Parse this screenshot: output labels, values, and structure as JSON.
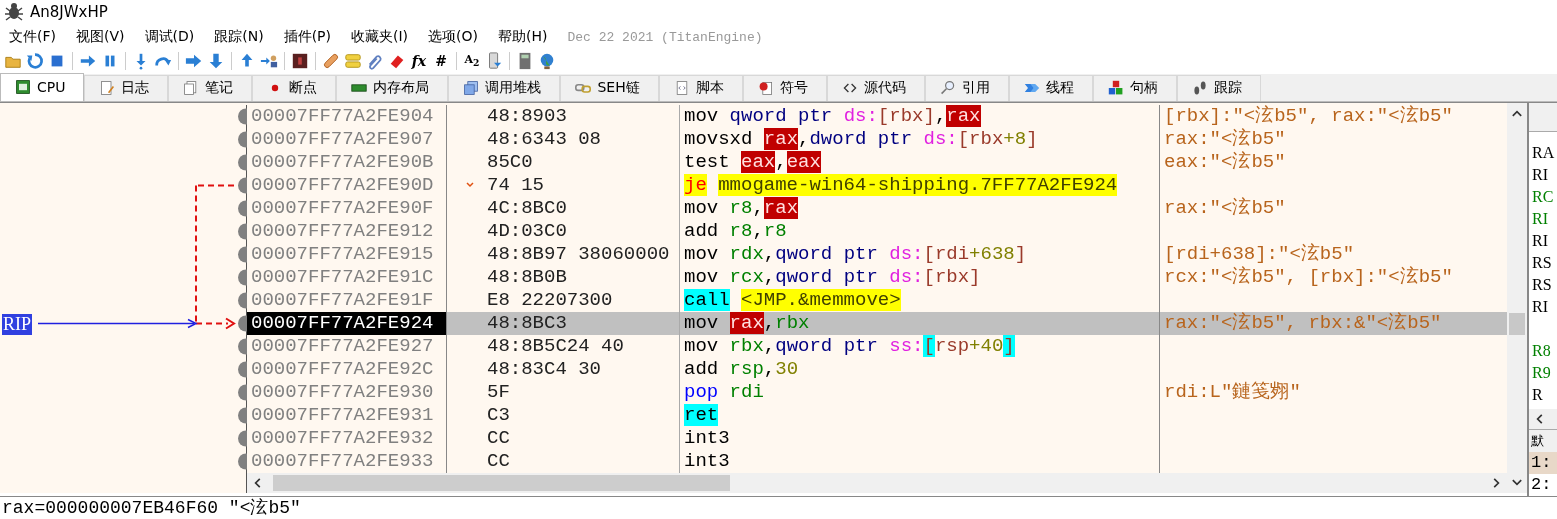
{
  "window": {
    "title": "An8JWxHP"
  },
  "menu": [
    {
      "label": "文件(F)"
    },
    {
      "label": "视图(V)"
    },
    {
      "label": "调试(D)"
    },
    {
      "label": "跟踪(N)"
    },
    {
      "label": "插件(P)"
    },
    {
      "label": "收藏夹(I)"
    },
    {
      "label": "选项(O)"
    },
    {
      "label": "帮助(H)"
    }
  ],
  "build_info": "Dec 22 2021 (TitanEngine)",
  "toolbar": {
    "glyphs": [
      "fx",
      "#",
      "A$_{2}$"
    ]
  },
  "tabs": [
    {
      "label": "CPU",
      "selected": true
    },
    {
      "label": "日志",
      "selected": false
    },
    {
      "label": "笔记",
      "selected": false
    },
    {
      "label": "断点",
      "selected": false
    },
    {
      "label": "内存布局",
      "selected": false
    },
    {
      "label": "调用堆栈",
      "selected": false
    },
    {
      "label": "SEH链",
      "selected": false
    },
    {
      "label": "脚本",
      "selected": false
    },
    {
      "label": "符号",
      "selected": false
    },
    {
      "label": "源代码",
      "selected": false
    },
    {
      "label": "引用",
      "selected": false
    },
    {
      "label": "线程",
      "selected": false
    },
    {
      "label": "句柄",
      "selected": false
    },
    {
      "label": "跟踪",
      "selected": false
    }
  ],
  "disassembly": {
    "rip_label": "RIP",
    "rows": [
      {
        "address": "00007FF77A2FE904",
        "bytes": "48:8903",
        "selected": false,
        "rip": false,
        "jump_source": false,
        "jump_target": false,
        "tokens": [
          {
            "t": "mov ",
            "kind": "op"
          },
          {
            "t": "qword ptr ",
            "kind": "size"
          },
          {
            "t": "ds:",
            "kind": "seg"
          },
          {
            "t": "[rbx]",
            "kind": "mem"
          },
          {
            "t": ",",
            "kind": "punct"
          },
          {
            "t": "rax",
            "kind": "reg_hl"
          }
        ],
        "comment": "[rbx]:\"<泫b5\", rax:\"<泫b5\""
      },
      {
        "address": "00007FF77A2FE907",
        "bytes": "48:6343 08",
        "selected": false,
        "rip": false,
        "jump_source": false,
        "jump_target": false,
        "tokens": [
          {
            "t": "movsxd ",
            "kind": "op"
          },
          {
            "t": "rax",
            "kind": "reg_hl"
          },
          {
            "t": ",",
            "kind": "punct"
          },
          {
            "t": "dword ptr ",
            "kind": "size"
          },
          {
            "t": "ds:",
            "kind": "seg"
          },
          {
            "t": "[rbx",
            "kind": "mem"
          },
          {
            "t": "+8",
            "kind": "num"
          },
          {
            "t": "]",
            "kind": "mem"
          }
        ],
        "comment": "rax:\"<泫b5\""
      },
      {
        "address": "00007FF77A2FE90B",
        "bytes": "85C0",
        "selected": false,
        "rip": false,
        "jump_source": false,
        "jump_target": false,
        "tokens": [
          {
            "t": "test ",
            "kind": "op"
          },
          {
            "t": "eax",
            "kind": "reg_hl"
          },
          {
            "t": ",",
            "kind": "punct"
          },
          {
            "t": "eax",
            "kind": "reg_hl"
          }
        ],
        "comment": "eax:\"<泫b5\""
      },
      {
        "address": "00007FF77A2FE90D",
        "bytes": "74 15",
        "selected": false,
        "rip": false,
        "jump_source": true,
        "jump_target": false,
        "tokens": [
          {
            "t": "je",
            "kind": "jump"
          },
          {
            "t": "mmogame-win64-shipping.7FF77A2FE924",
            "kind": "label"
          }
        ]
      },
      {
        "address": "00007FF77A2FE90F",
        "bytes": "4C:8BC0",
        "selected": false,
        "rip": false,
        "jump_source": false,
        "jump_target": false,
        "tokens": [
          {
            "t": "mov ",
            "kind": "op"
          },
          {
            "t": "r8",
            "kind": "reg"
          },
          {
            "t": ",",
            "kind": "punct"
          },
          {
            "t": "rax",
            "kind": "reg_hl"
          }
        ],
        "comment": "rax:\"<泫b5\""
      },
      {
        "address": "00007FF77A2FE912",
        "bytes": "4D:03C0",
        "selected": false,
        "rip": false,
        "jump_source": false,
        "jump_target": false,
        "tokens": [
          {
            "t": "add ",
            "kind": "op"
          },
          {
            "t": "r8",
            "kind": "reg"
          },
          {
            "t": ",",
            "kind": "punct"
          },
          {
            "t": "r8",
            "kind": "reg"
          }
        ]
      },
      {
        "address": "00007FF77A2FE915",
        "bytes": "48:8B97 38060000",
        "selected": false,
        "rip": false,
        "jump_source": false,
        "jump_target": false,
        "tokens": [
          {
            "t": "mov ",
            "kind": "op"
          },
          {
            "t": "rdx",
            "kind": "reg"
          },
          {
            "t": ",",
            "kind": "punct"
          },
          {
            "t": "qword ptr ",
            "kind": "size"
          },
          {
            "t": "ds:",
            "kind": "seg"
          },
          {
            "t": "[rdi",
            "kind": "mem"
          },
          {
            "t": "+638",
            "kind": "num"
          },
          {
            "t": "]",
            "kind": "mem"
          }
        ],
        "comment": "[rdi+638]:\"<泫b5\""
      },
      {
        "address": "00007FF77A2FE91C",
        "bytes": "48:8B0B",
        "selected": false,
        "rip": false,
        "jump_source": false,
        "jump_target": false,
        "tokens": [
          {
            "t": "mov ",
            "kind": "op"
          },
          {
            "t": "rcx",
            "kind": "reg"
          },
          {
            "t": ",",
            "kind": "punct"
          },
          {
            "t": "qword ptr ",
            "kind": "size"
          },
          {
            "t": "ds:",
            "kind": "seg"
          },
          {
            "t": "[rbx]",
            "kind": "mem"
          }
        ],
        "comment": "rcx:\"<泫b5\", [rbx]:\"<泫b5\""
      },
      {
        "address": "00007FF77A2FE91F",
        "bytes": "E8 22207300",
        "selected": false,
        "rip": false,
        "jump_source": false,
        "jump_target": false,
        "tokens": [
          {
            "t": "call",
            "kind": "call"
          },
          {
            "t": "<JMP.&memmove>",
            "kind": "label"
          }
        ]
      },
      {
        "address": "00007FF77A2FE924",
        "bytes": "48:8BC3",
        "selected": true,
        "rip": true,
        "jump_source": false,
        "jump_target": true,
        "tokens": [
          {
            "t": "mov ",
            "kind": "op"
          },
          {
            "t": "rax",
            "kind": "reg_hl"
          },
          {
            "t": ",",
            "kind": "punct"
          },
          {
            "t": "rbx",
            "kind": "reg"
          }
        ],
        "comment": "rax:\"<泫b5\", rbx:&\"<泫b5\""
      },
      {
        "address": "00007FF77A2FE927",
        "bytes": "48:8B5C24 40",
        "selected": false,
        "rip": false,
        "jump_source": false,
        "jump_target": false,
        "tokens": [
          {
            "t": "mov ",
            "kind": "op"
          },
          {
            "t": "rbx",
            "kind": "reg"
          },
          {
            "t": ",",
            "kind": "punct"
          },
          {
            "t": "qword ptr ",
            "kind": "size"
          },
          {
            "t": "ss:",
            "kind": "seg"
          },
          {
            "t": "[",
            "kind": "brk_hl"
          },
          {
            "t": "rsp",
            "kind": "mem"
          },
          {
            "t": "+40",
            "kind": "num"
          },
          {
            "t": "]",
            "kind": "brk_hl"
          }
        ]
      },
      {
        "address": "00007FF77A2FE92C",
        "bytes": "48:83C4 30",
        "selected": false,
        "rip": false,
        "jump_source": false,
        "jump_target": false,
        "tokens": [
          {
            "t": "add ",
            "kind": "op"
          },
          {
            "t": "rsp",
            "kind": "reg"
          },
          {
            "t": ",",
            "kind": "punct"
          },
          {
            "t": "30",
            "kind": "num"
          }
        ]
      },
      {
        "address": "00007FF77A2FE930",
        "bytes": "5F",
        "selected": false,
        "rip": false,
        "jump_source": false,
        "jump_target": false,
        "tokens": [
          {
            "t": "pop ",
            "kind": "stack"
          },
          {
            "t": "rdi",
            "kind": "reg"
          }
        ],
        "comment": "rdi:L\"鏈笺翙\""
      },
      {
        "address": "00007FF77A2FE931",
        "bytes": "C3",
        "selected": false,
        "rip": false,
        "jump_source": false,
        "jump_target": false,
        "tokens": [
          {
            "t": "ret",
            "kind": "call"
          }
        ]
      },
      {
        "address": "00007FF77A2FE932",
        "bytes": "CC",
        "selected": false,
        "rip": false,
        "jump_source": false,
        "jump_target": false,
        "tokens": [
          {
            "t": "int3",
            "kind": "op"
          }
        ]
      },
      {
        "address": "00007FF77A2FE933",
        "bytes": "CC",
        "selected": false,
        "rip": false,
        "jump_source": false,
        "jump_target": false,
        "tokens": [
          {
            "t": "int3",
            "kind": "op"
          }
        ]
      }
    ]
  },
  "registers_panel": {
    "registers_top": [
      {
        "name": "RA",
        "color": "#000000"
      },
      {
        "name": "RI",
        "color": "#000000"
      },
      {
        "name": "RC",
        "color": "#008000"
      },
      {
        "name": "RI",
        "color": "#008000"
      },
      {
        "name": "RI",
        "color": "#000000"
      },
      {
        "name": "RS",
        "color": "#000000"
      },
      {
        "name": "RS",
        "color": "#000000"
      },
      {
        "name": "RI",
        "color": "#000000"
      }
    ],
    "registers_bottom": [
      {
        "name": "R8",
        "color": "#008000"
      },
      {
        "name": "R9",
        "color": "#008000"
      },
      {
        "name": "R",
        "color": "#000000"
      }
    ],
    "stack_tab": "默",
    "stack_rows": [
      {
        "label": "1:",
        "selected": true
      },
      {
        "label": "2:",
        "selected": false
      }
    ]
  },
  "info_line": "rax=000000007EB46F60 \"<泫b5\""
}
